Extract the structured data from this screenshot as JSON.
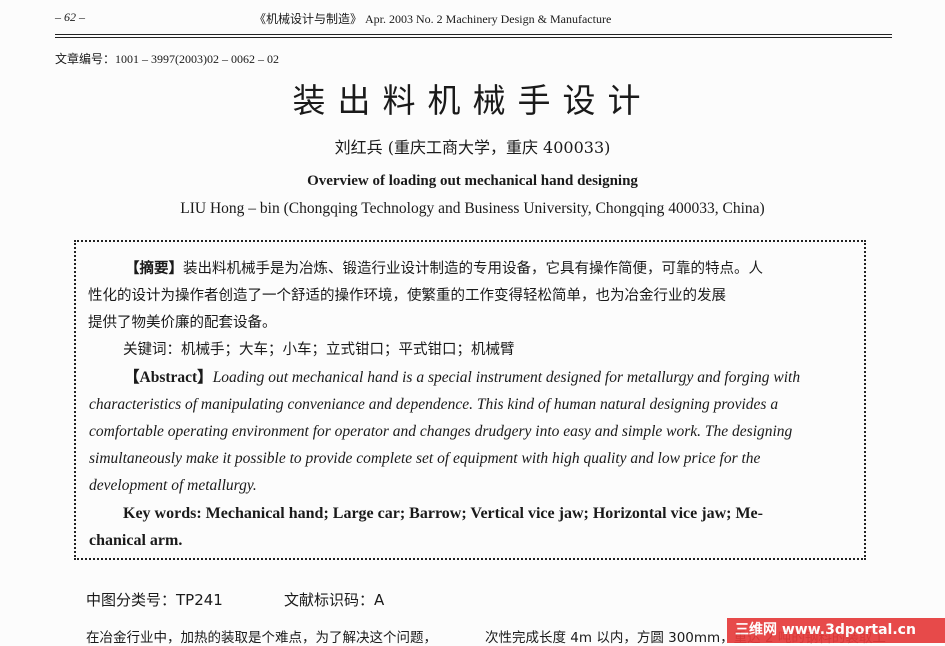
{
  "header": {
    "page": "– 62 –",
    "journal": "《机械设计与制造》 Apr. 2003 No. 2 Machinery Design & Manufacture"
  },
  "article_no": "文章编号：1001 – 3997(2003)02 – 0062 – 02",
  "title_cn": "装出料机械手设计",
  "author_cn": "刘红兵 (重庆工商大学，重庆 400033)",
  "title_en": "Overview of loading out mechanical hand designing",
  "author_en": "LIU Hong – bin (Chongqing Technology and Business University, Chongqing 400033, China)",
  "abstract_cn": {
    "label": "【摘要】",
    "line1": "装出料机械手是为冶炼、锻造行业设计制造的专用设备，它具有操作简便，可靠的特点。人",
    "line2": "性化的设计为操作者创造了一个舒适的操作环境，使繁重的工作变得轻松简单，也为冶金行业的发展",
    "line3": "提供了物美价廉的配套设备。"
  },
  "keywords_cn": "关键词：机械手；大车；小车；立式钳口；平式钳口；机械臂",
  "abstract_en": {
    "label": "【Abstract】",
    "line1": "Loading out mechanical hand is a special instrument designed for metallurgy and forging with",
    "line2": "characteristics of manipulating conveniance and dependence.  This kind of human natural designing provides a",
    "line3": "comfortable operating environment for operator and changes drudgery into easy and simple work.  The designing",
    "line4": "simultaneously make it possible to provide complete set of equipment with high quality and low price for the",
    "line5": "development  of metallurgy."
  },
  "keywords_en": {
    "line1": "Key words: Mechanical hand; Large car; Barrow; Vertical vice jaw; Horizontal vice jaw; Me-",
    "line2": "chanical arm."
  },
  "classification": "中图分类号：TP241",
  "document_code": "文献标识码：A",
  "body": {
    "left_col": "在冶金行业中，加热的装取是个难点，为了解决这个问题，",
    "right_col": "次性完成长度 4m 以内，方圆 300mm，重达 2 吨的钢料的装取工"
  },
  "watermark": "三维网 www.3dportal.cn"
}
